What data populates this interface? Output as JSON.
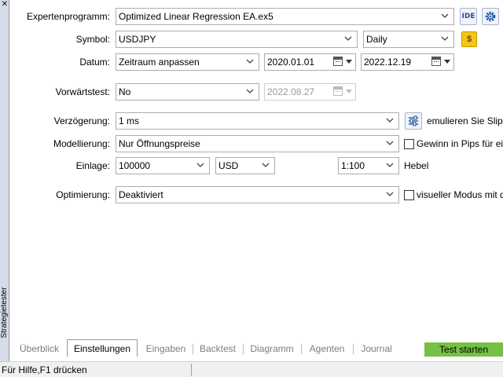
{
  "window": {
    "close_glyph": "✕",
    "side_title": "Strategietester"
  },
  "form": {
    "expert": {
      "label": "Expertenprogramm:",
      "value": "Optimized Linear Regression EA.ex5",
      "ide_label": "IDE"
    },
    "symbol": {
      "label": "Symbol:",
      "value": "USDJPY",
      "period": "Daily",
      "spec_glyph": "$"
    },
    "dates": {
      "label": "Datum:",
      "range": "Zeitraum anpassen",
      "from": "2020.01.01",
      "to": "2022.12.19"
    },
    "forward": {
      "label": "Vorwärtstest:",
      "value": "No",
      "date": "2022.08.27"
    },
    "delay": {
      "label": "Verzögerung:",
      "value": "1 ms",
      "slippage_text": "emulieren Sie Slippag"
    },
    "modeling": {
      "label": "Modellierung:",
      "value": "Nur Öffnungspreise",
      "pips_text": "Gewinn in Pips für eine",
      "pips_checked": false
    },
    "deposit": {
      "label": "Einlage:",
      "amount": "100000",
      "currency": "USD",
      "leverage": "1:100",
      "leverage_label": "Hebel"
    },
    "optimization": {
      "label": "Optimierung:",
      "value": "Deaktiviert",
      "visual_text": "visueller Modus mit der",
      "visual_checked": false
    }
  },
  "tabs": [
    {
      "label": "Überblick",
      "active": false
    },
    {
      "label": "Einstellungen",
      "active": true
    },
    {
      "label": "Eingaben",
      "active": false
    },
    {
      "label": "Backtest",
      "active": false
    },
    {
      "label": "Diagramm",
      "active": false
    },
    {
      "label": "Agenten",
      "active": false
    },
    {
      "label": "Journal",
      "active": false
    }
  ],
  "start_button": "Test starten",
  "status": {
    "text": "Für Hilfe,F1 drücken"
  },
  "colors": {
    "start_button": "#76c043",
    "coin": "#f5c518",
    "ide_text": "#1b4f9c"
  },
  "icons": [
    "close-icon",
    "settings-gear-icon",
    "currency-icon",
    "calendar-icon",
    "sliders-icon",
    "chevron-down-icon"
  ]
}
